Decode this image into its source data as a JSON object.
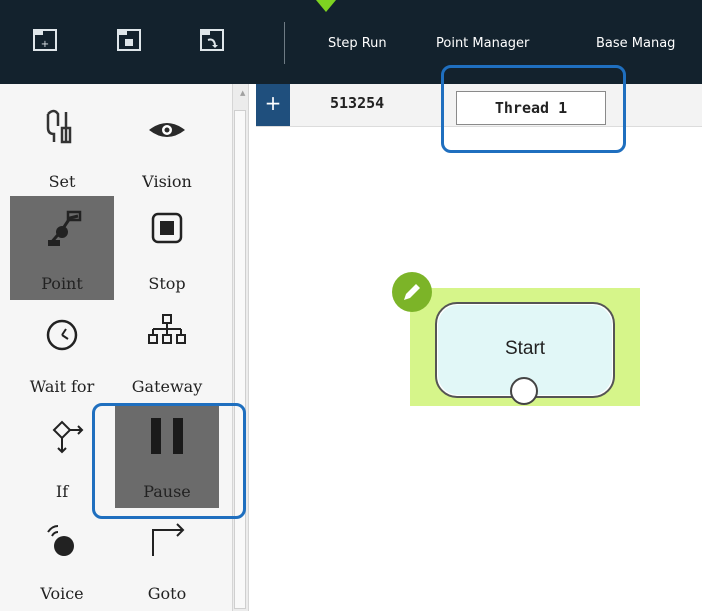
{
  "toolbar": {
    "icons": [
      "folder-add-icon",
      "folder-save-icon",
      "folder-open-icon"
    ],
    "menu": {
      "step_run": "Step Run",
      "point_manager": "Point Manager",
      "base_manager": "Base Manag"
    }
  },
  "palette": {
    "items": [
      {
        "label": "Set",
        "icon": "wrench-icon",
        "active": false
      },
      {
        "label": "Vision",
        "icon": "eye-icon",
        "active": false
      },
      {
        "label": "Point",
        "icon": "robot-arm-icon",
        "active": true
      },
      {
        "label": "Stop",
        "icon": "stop-icon",
        "active": false
      },
      {
        "label": "Wait for",
        "icon": "timer-icon",
        "active": false
      },
      {
        "label": "Gateway",
        "icon": "hierarchy-icon",
        "active": false
      },
      {
        "label": "If",
        "icon": "decision-icon",
        "active": false
      },
      {
        "label": "Pause",
        "icon": "pause-icon",
        "active": true
      },
      {
        "label": "Voice",
        "icon": "voice-icon",
        "active": false
      },
      {
        "label": "Goto",
        "icon": "goto-arrow-icon",
        "active": false
      }
    ]
  },
  "tabs": {
    "add_label": "+",
    "project_id": "513254",
    "thread_label": "Thread 1"
  },
  "flow": {
    "start_label": "Start"
  },
  "colors": {
    "topbar": "#13222d",
    "highlight": "#1f6fbf",
    "node_bg": "#d6f58a",
    "edit_badge": "#7cb428"
  }
}
